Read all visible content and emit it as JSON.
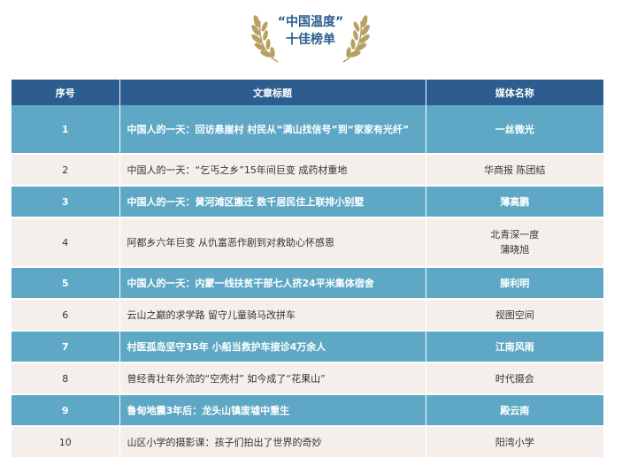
{
  "heading": {
    "line1": "“中国温度”",
    "line2": "十佳榜单"
  },
  "table": {
    "columns": [
      "序号",
      "文章标题",
      "媒体名称"
    ],
    "rows": [
      {
        "no": "1",
        "title": "中国人的一天：回访悬崖村 村民从“满山找信号”到“家家有光纤”",
        "media": "一丝微光",
        "highlight": true
      },
      {
        "no": "2",
        "title": "中国人的一天：“乞丐之乡”15年间巨变 成药材重地",
        "media": "华商报 陈团结",
        "highlight": false
      },
      {
        "no": "3",
        "title": "中国人的一天：黄河滩区搬迁 数千居民住上联排小别墅",
        "media": "薄高鹏",
        "highlight": true
      },
      {
        "no": "4",
        "title": "阿都乡六年巨变 从仇富恶作剧到对救助心怀感恩",
        "media": "北青深一度\n蒲晓旭",
        "highlight": false
      },
      {
        "no": "5",
        "title": "中国人的一天：内蒙一线扶贫干部七人挤24平米集体宿舍",
        "media": "滕利明",
        "highlight": true
      },
      {
        "no": "6",
        "title": "云山之巅的求学路 留守儿童骑马改拼车",
        "media": "视图空间",
        "highlight": false
      },
      {
        "no": "7",
        "title": "村医孤岛坚守35年 小船当救护车接诊4万余人",
        "media": "江南风雨",
        "highlight": true
      },
      {
        "no": "8",
        "title": "曾经青壮年外流的“空壳村” 如今成了“花果山”",
        "media": "时代摄会",
        "highlight": false
      },
      {
        "no": "9",
        "title": "鲁甸地震3年后：龙头山镇废墟中重生",
        "media": "殿云南",
        "highlight": true
      },
      {
        "no": "10",
        "title": "山区小学的摄影课：孩子们拍出了世界的奇妙",
        "media": "阳湾小学",
        "highlight": false
      }
    ]
  },
  "colors": {
    "header_bg": "#2d5d8e",
    "highlight_row": "#5ea8c5",
    "plain_row": "#f5efeb",
    "laurel": "#b8a063"
  },
  "icons": [
    "laurel-left-icon",
    "laurel-right-icon"
  ]
}
